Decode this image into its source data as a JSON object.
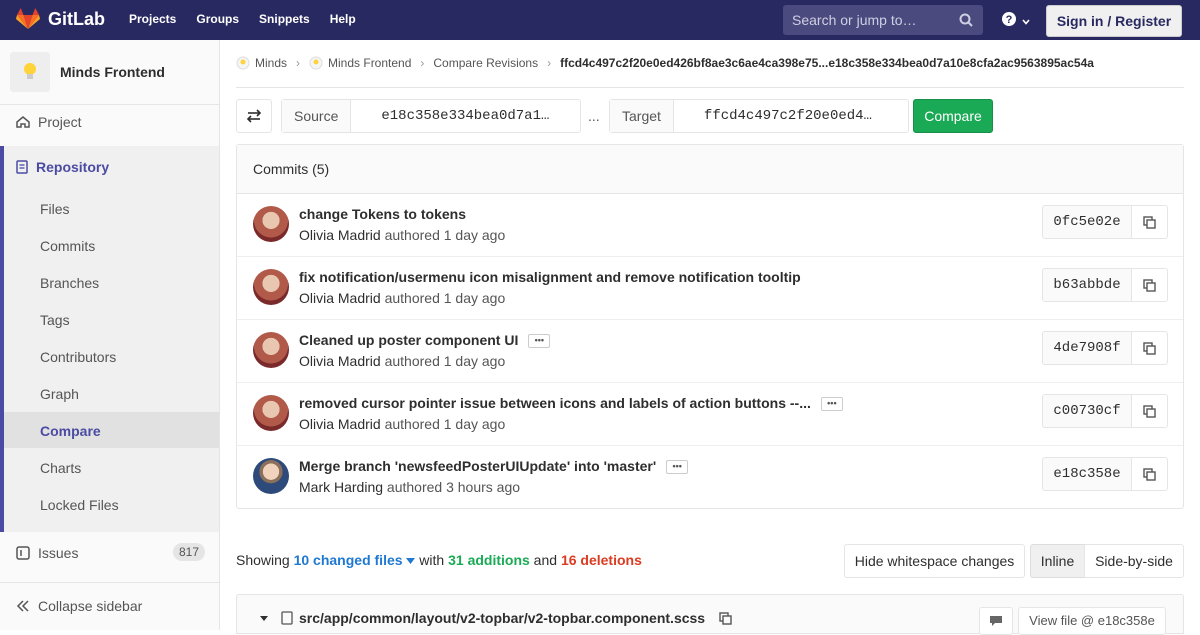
{
  "app": {
    "name": "GitLab"
  },
  "topnav": {
    "items": [
      "Projects",
      "Groups",
      "Snippets",
      "Help"
    ],
    "search_placeholder": "Search or jump to…",
    "signin_label": "Sign in / Register"
  },
  "sidebar": {
    "project_name": "Minds Frontend",
    "project_label": "Project",
    "repository_label": "Repository",
    "repo_items": [
      "Files",
      "Commits",
      "Branches",
      "Tags",
      "Contributors",
      "Graph",
      "Compare",
      "Charts",
      "Locked Files"
    ],
    "active_item": "Compare",
    "issues_label": "Issues",
    "issues_count": "817",
    "collapse_label": "Collapse sidebar"
  },
  "breadcrumbs": [
    "Minds",
    "Minds Frontend",
    "Compare Revisions",
    "ffcd4c497c2f20e0ed426bf8ae3c6ae4ca398e75...e18c358e334bea0d7a10e8cfa2ac9563895ac54a"
  ],
  "compare_form": {
    "source_label": "Source",
    "source_value": "e18c358e334bea0d7a1…",
    "separator": "...",
    "target_label": "Target",
    "target_value": "ffcd4c497c2f20e0ed4…",
    "compare_button": "Compare"
  },
  "commits": {
    "header": "Commits (5)",
    "items": [
      {
        "title": "change Tokens to tokens",
        "author": "Olivia Madrid",
        "meta": " authored 1 day ago",
        "sha": "0fc5e02e",
        "has_more": false
      },
      {
        "title": "fix notification/usermenu icon misalignment and remove notification tooltip",
        "author": "Olivia Madrid",
        "meta": " authored 1 day ago",
        "sha": "b63abbde",
        "has_more": false
      },
      {
        "title": "Cleaned up poster component UI",
        "author": "Olivia Madrid",
        "meta": " authored 1 day ago",
        "sha": "4de7908f",
        "has_more": true
      },
      {
        "title": "removed cursor pointer issue between icons and labels of action buttons --...",
        "author": "Olivia Madrid",
        "meta": " authored 1 day ago",
        "sha": "c00730cf",
        "has_more": true
      },
      {
        "title": "Merge branch 'newsfeedPosterUIUpdate' into 'master'",
        "author": "Mark Harding",
        "meta": " authored 3 hours ago",
        "sha": "e18c358e",
        "has_more": true
      }
    ]
  },
  "changes": {
    "showing": "Showing ",
    "files": "10 changed files",
    "with": " with ",
    "additions": "31 additions",
    "and": " and ",
    "deletions": "16 deletions",
    "hide_whitespace": "Hide whitespace changes",
    "inline": "Inline",
    "side_by_side": "Side-by-side"
  },
  "file": {
    "path": "src/app/common/layout/v2-topbar/v2-topbar.component.scss",
    "view_file": "View file @ e18c358e"
  },
  "colors": {
    "topbar": "#292961",
    "accent": "#4b4ba3",
    "green": "#1aaa55",
    "red": "#db3b21",
    "blue": "#1f78d1"
  }
}
